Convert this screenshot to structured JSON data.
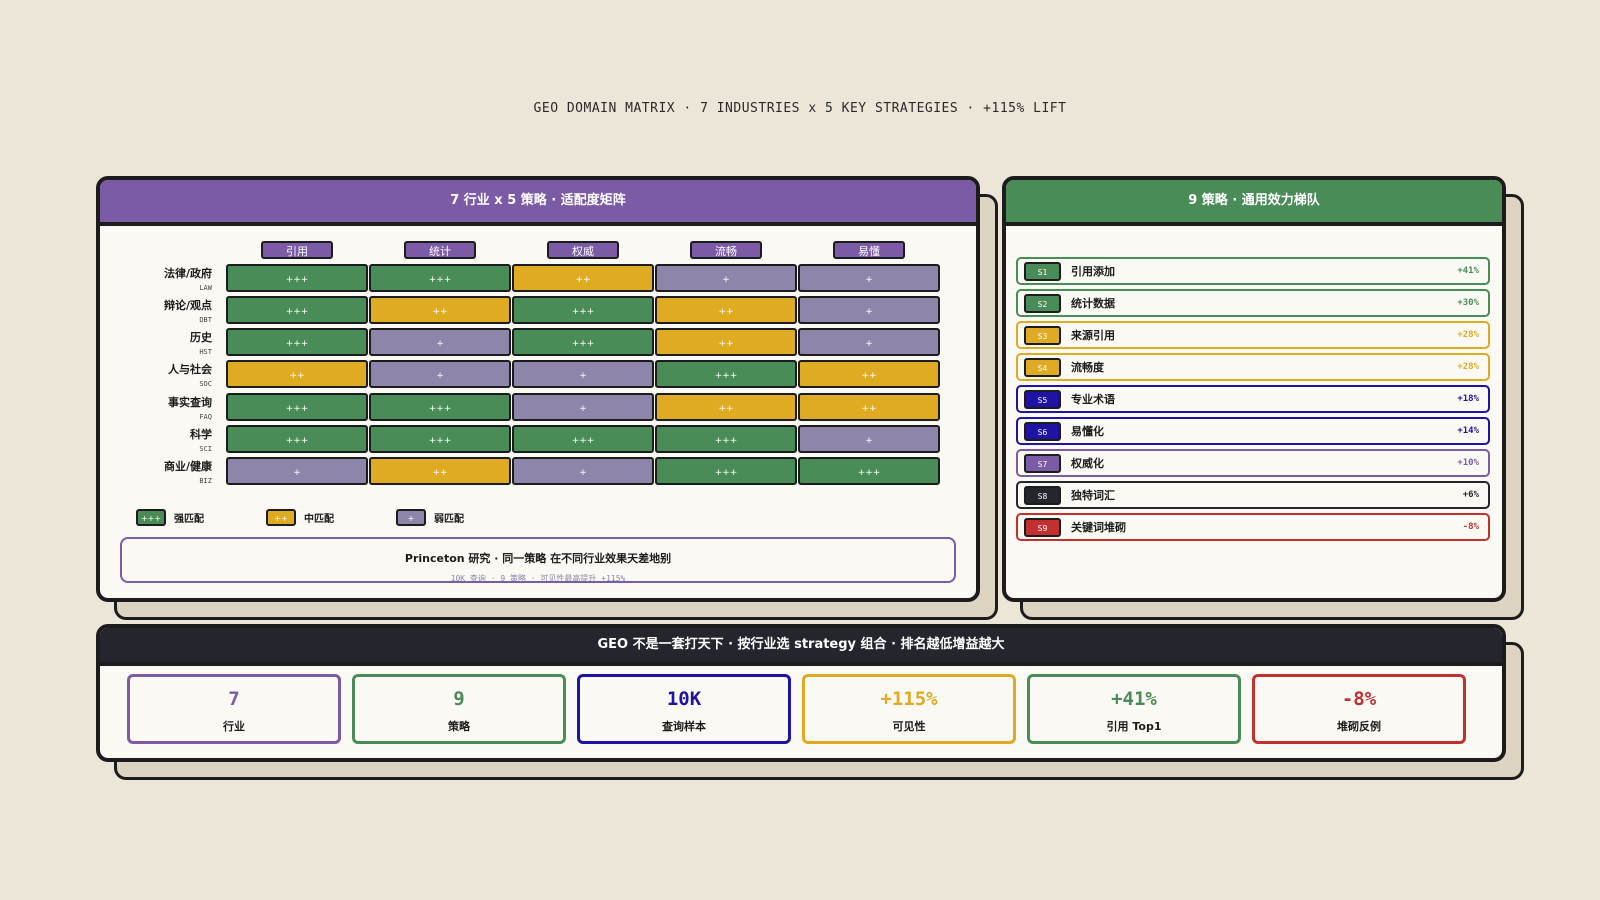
{
  "page_title": "GEO DOMAIN MATRIX · 7 INDUSTRIES x 5 KEY STRATEGIES · +115% LIFT",
  "matrix_panel": {
    "title": "7 行业 x 5 策略 · 适配度矩阵",
    "columns": [
      "引用",
      "统计",
      "权威",
      "流畅",
      "易懂"
    ],
    "rows": [
      {
        "label": "法律/政府",
        "code": "LAW",
        "cells": [
          "+++",
          "+++",
          "++",
          "+",
          "+"
        ]
      },
      {
        "label": "辩论/观点",
        "code": "DBT",
        "cells": [
          "+++",
          "++",
          "+++",
          "++",
          "+"
        ]
      },
      {
        "label": "历史",
        "code": "HST",
        "cells": [
          "+++",
          "+",
          "+++",
          "++",
          "+"
        ]
      },
      {
        "label": "人与社会",
        "code": "SOC",
        "cells": [
          "++",
          "+",
          "+",
          "+++",
          "++"
        ]
      },
      {
        "label": "事实查询",
        "code": "FAQ",
        "cells": [
          "+++",
          "+++",
          "+",
          "++",
          "++"
        ]
      },
      {
        "label": "科学",
        "code": "SCI",
        "cells": [
          "+++",
          "+++",
          "+++",
          "+++",
          "+"
        ]
      },
      {
        "label": "商业/健康",
        "code": "BIZ",
        "cells": [
          "+",
          "++",
          "+",
          "+++",
          "+++"
        ]
      }
    ],
    "legend": [
      {
        "symbol": "+++",
        "label": "强匹配",
        "color": "#4a8c58"
      },
      {
        "symbol": "++",
        "label": "中匹配",
        "color": "#deab22"
      },
      {
        "symbol": "+",
        "label": "弱匹配",
        "color": "#8e86aa"
      }
    ],
    "note": {
      "title": "Princeton 研究 · 同一策略 在不同行业效果天差地别",
      "subtitle": "10K 查询 · 9 策略 · 可见性最高提升 +115%"
    }
  },
  "tier_panel": {
    "title": "9 策略 · 通用效力梯队",
    "items": [
      {
        "id": "S1",
        "name": "引用添加",
        "lift": "+41%",
        "color": "#4a8c58"
      },
      {
        "id": "S2",
        "name": "统计数据",
        "lift": "+30%",
        "color": "#4a8c58"
      },
      {
        "id": "S3",
        "name": "来源引用",
        "lift": "+28%",
        "color": "#deab22"
      },
      {
        "id": "S4",
        "name": "流畅度",
        "lift": "+28%",
        "color": "#deab22"
      },
      {
        "id": "S5",
        "name": "专业术语",
        "lift": "+18%",
        "color": "#1f13a3"
      },
      {
        "id": "S6",
        "name": "易懂化",
        "lift": "+14%",
        "color": "#1f13a3"
      },
      {
        "id": "S7",
        "name": "权威化",
        "lift": "+10%",
        "color": "#7c5ba6"
      },
      {
        "id": "S8",
        "name": "独特词汇",
        "lift": "+6%",
        "color": "#25252d"
      },
      {
        "id": "S9",
        "name": "关键词堆砌",
        "lift": "-8%",
        "color": "#c23030"
      }
    ]
  },
  "summary": {
    "title": "GEO 不是一套打天下 · 按行业选 strategy 组合 · 排名越低增益越大",
    "stats": [
      {
        "value": "7",
        "label": "行业",
        "color": "#7c5ba6"
      },
      {
        "value": "9",
        "label": "策略",
        "color": "#4a8c58"
      },
      {
        "value": "10K",
        "label": "查询样本",
        "color": "#1f13a3"
      },
      {
        "value": "+115%",
        "label": "可见性",
        "color": "#deab22"
      },
      {
        "value": "+41%",
        "label": "引用 Top1",
        "color": "#4a8c58"
      },
      {
        "value": "-8%",
        "label": "堆砌反例",
        "color": "#c23030"
      }
    ]
  }
}
